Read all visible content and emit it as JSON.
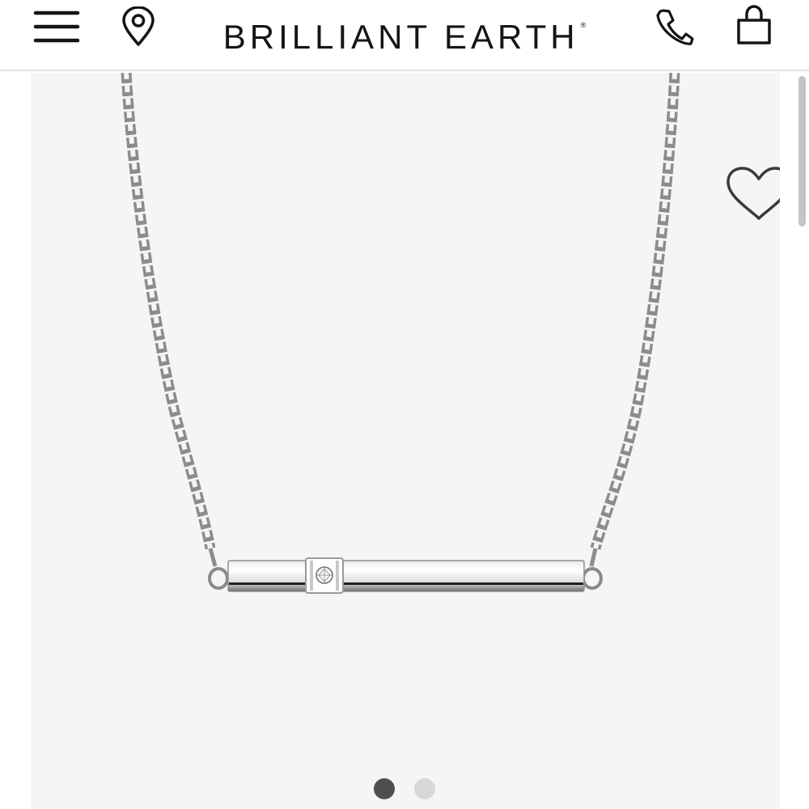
{
  "header": {
    "brand_name": "BRILLIANT EARTH",
    "brand_mark": "®",
    "icons": [
      "menu-icon",
      "location-icon",
      "phone-icon",
      "bag-icon"
    ]
  },
  "gallery": {
    "image": "necklace-bar-single-diamond",
    "wishlist_icon": "heart-icon",
    "slide_count": 2,
    "active_slide": 1
  },
  "colors": {
    "text": "#151515",
    "header_border": "#e2e2e2",
    "gallery_background": "#f5f5f5",
    "active_dot": "#4f4f4f",
    "inactive_dot": "#d7d7d7",
    "scrollbar_thumb": "#c4c4c4"
  }
}
